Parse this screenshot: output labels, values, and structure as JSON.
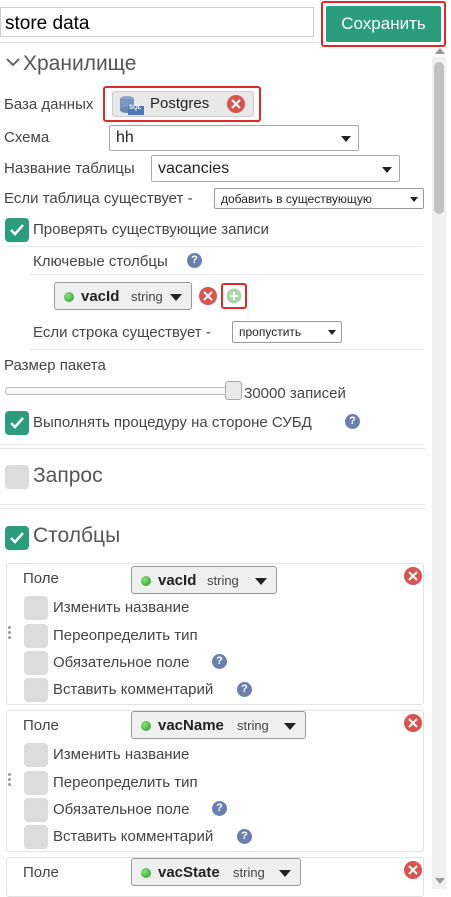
{
  "header": {
    "title_value": "store data",
    "save_label": "Сохранить"
  },
  "storage": {
    "title": "Хранилище",
    "db_label": "База данных",
    "db_name": "Postgres",
    "db_icon_text": "SQL",
    "schema_label": "Схема",
    "schema_value": "hh",
    "table_label": "Название таблицы",
    "table_value": "vacancies",
    "if_exists_label": "Если таблица существует -",
    "if_exists_value": "добавить в существующую",
    "check_existing_label": "Проверять существующие записи",
    "check_existing_checked": true,
    "key_columns_label": "Ключевые столбцы",
    "key_column": {
      "name": "vacId",
      "type": "string"
    },
    "if_row_exists_label": "Если строка существует -",
    "if_row_exists_value": "пропустить",
    "batch_label": "Размер пакета",
    "batch_value_text": "30000 записей",
    "batch_slider_fraction": 1.0,
    "server_proc_label": "Выполнять процедуру на стороне СУБД",
    "server_proc_checked": true
  },
  "query": {
    "title": "Запрос",
    "checked": false
  },
  "columns": {
    "title": "Столбцы",
    "checked": true,
    "field_label": "Поле",
    "options": [
      "Изменить название",
      "Переопределить тип",
      "Обязательное поле",
      "Вставить комментарий"
    ],
    "items": [
      {
        "name": "vacId",
        "type": "string"
      },
      {
        "name": "vacName",
        "type": "string"
      },
      {
        "name": "vacState",
        "type": "string"
      }
    ]
  },
  "help_glyph": "?",
  "colors": {
    "accent": "#2a9d7c",
    "highlight": "#e02a2a",
    "remove": "#d9534f",
    "status_dot": "#2db52d"
  }
}
